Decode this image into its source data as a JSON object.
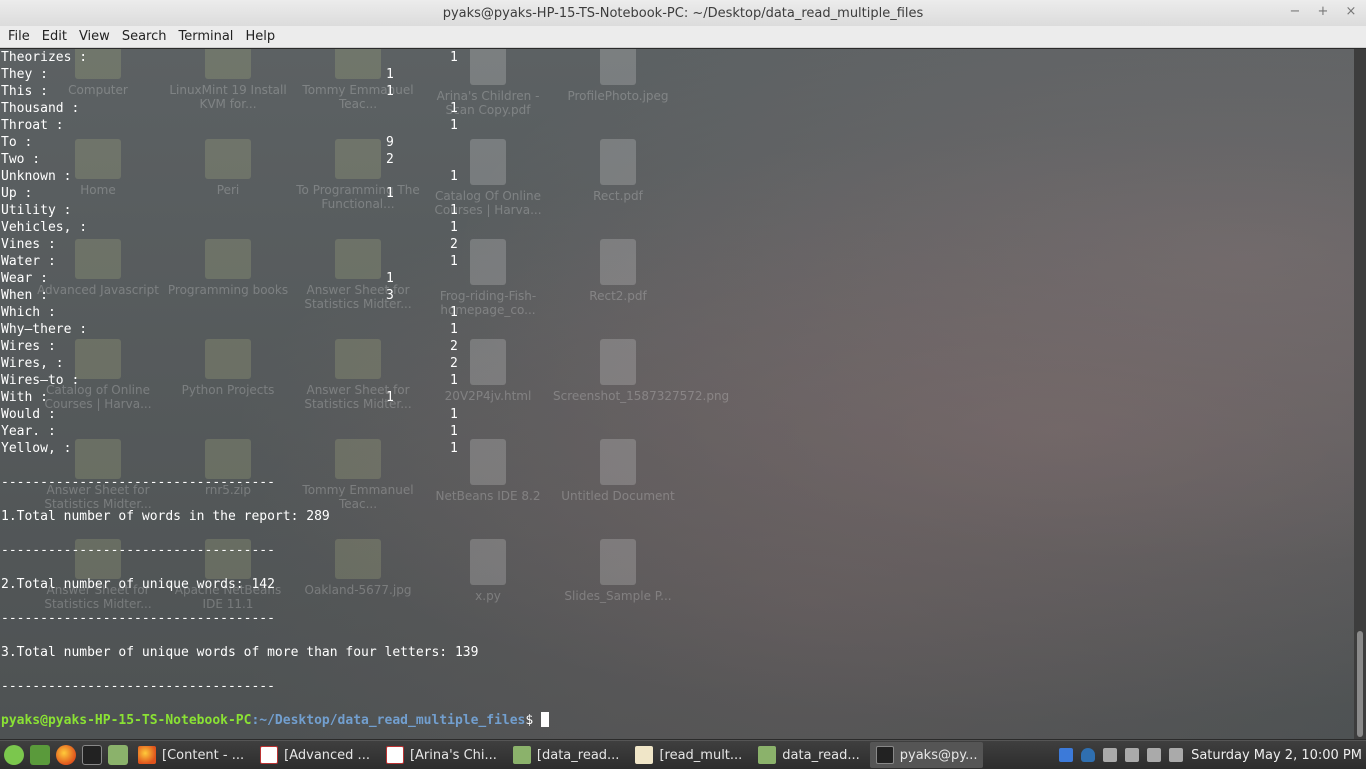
{
  "window": {
    "title": "pyaks@pyaks-HP-15-TS-Notebook-PC: ~/Desktop/data_read_multiple_files",
    "controls": [
      "−",
      "+",
      "×"
    ]
  },
  "menu": [
    "File",
    "Edit",
    "View",
    "Search",
    "Terminal",
    "Help"
  ],
  "terminal": {
    "word_counts": [
      {
        "word": "Theorizes :",
        "count": "1",
        "col": "wide"
      },
      {
        "word": "They :",
        "count": "1",
        "col": "tight"
      },
      {
        "word": "This :",
        "count": "1",
        "col": "tight"
      },
      {
        "word": "Thousand :",
        "count": "1",
        "col": "wide"
      },
      {
        "word": "Throat :",
        "count": "1",
        "col": "wide"
      },
      {
        "word": "To :",
        "count": "9",
        "col": "tight"
      },
      {
        "word": "Two :",
        "count": "2",
        "col": "tight"
      },
      {
        "word": "Unknown :",
        "count": "1",
        "col": "wide"
      },
      {
        "word": "Up :",
        "count": "1",
        "col": "tight"
      },
      {
        "word": "Utility :",
        "count": "1",
        "col": "wide"
      },
      {
        "word": "Vehicles, :",
        "count": "1",
        "col": "wide"
      },
      {
        "word": "Vines :",
        "count": "2",
        "col": "wide"
      },
      {
        "word": "Water :",
        "count": "1",
        "col": "wide"
      },
      {
        "word": "Wear :",
        "count": "1",
        "col": "tight"
      },
      {
        "word": "When :",
        "count": "3",
        "col": "tight"
      },
      {
        "word": "Which :",
        "count": "1",
        "col": "wide"
      },
      {
        "word": "Why—there :",
        "count": "1",
        "col": "wide"
      },
      {
        "word": "Wires :",
        "count": "2",
        "col": "wide"
      },
      {
        "word": "Wires, :",
        "count": "2",
        "col": "wide"
      },
      {
        "word": "Wires—to :",
        "count": "1",
        "col": "wide"
      },
      {
        "word": "With :",
        "count": "1",
        "col": "tight"
      },
      {
        "word": "Would :",
        "count": "1",
        "col": "wide"
      },
      {
        "word": "Year. :",
        "count": "1",
        "col": "wide"
      },
      {
        "word": "Yellow, :",
        "count": "1",
        "col": "wide"
      }
    ],
    "separator": "-----------------------------------",
    "total_words": "1.Total number of words in the report: 289",
    "unique_words": "2.Total number of unique words: 142",
    "unique_long_words": "3.Total number of unique words of more than four letters: 139",
    "prompt_user": "pyaks@pyaks-HP-15-TS-Notebook-PC",
    "prompt_path": ":~/Desktop/data_read_multiple_files",
    "prompt_symbol": "$ "
  },
  "desktop_icons": [
    {
      "label": "Computer"
    },
    {
      "label": "LinuxMint 19 Install KVM for..."
    },
    {
      "label": "Tommy Emmanuel Teac..."
    },
    {
      "label": "Arina's Children - Scan Copy.pdf"
    },
    {
      "label": "ProfilePhoto.jpeg"
    },
    {
      "label": "Home"
    },
    {
      "label": "Peri"
    },
    {
      "label": "To Programming The Functional..."
    },
    {
      "label": "Catalog Of Online Courses | Harva..."
    },
    {
      "label": "Rect.pdf"
    },
    {
      "label": "Advanced Javascript"
    },
    {
      "label": "Programming books"
    },
    {
      "label": "Answer Sheet for Statistics Midter..."
    },
    {
      "label": "Frog-riding-Fish-homepage_co..."
    },
    {
      "label": "Rect2.pdf"
    },
    {
      "label": "Catalog of Online Courses | Harva..."
    },
    {
      "label": "Python Projects"
    },
    {
      "label": "Answer Sheet for Statistics Midter..."
    },
    {
      "label": "20V2P4jv.html"
    },
    {
      "label": "Screenshot_1587327572.png"
    },
    {
      "label": "Answer Sheet for Statistics Midter..."
    },
    {
      "label": "rnr5.zip"
    },
    {
      "label": "Tommy Emmanuel Teac..."
    },
    {
      "label": "NetBeans IDE 8.2"
    },
    {
      "label": "Untitled Document"
    },
    {
      "label": "Answer Sheet for Statistics Midter..."
    },
    {
      "label": "Apache NetBeans IDE 11.1"
    },
    {
      "label": "Oakland-5677.jpg"
    },
    {
      "label": "x.py"
    },
    {
      "label": "Slides_Sample P..."
    }
  ],
  "taskbar": {
    "tasks": [
      {
        "label": "[Content - ...",
        "icon": "firefox-icon"
      },
      {
        "label": "[Advanced ...",
        "icon": "pdf-icon"
      },
      {
        "label": "[Arina's Chi...",
        "icon": "pdf-icon"
      },
      {
        "label": "[data_read...",
        "icon": "folder-icon"
      },
      {
        "label": "[read_mult...",
        "icon": "text-editor-icon"
      },
      {
        "label": "data_read...",
        "icon": "folder-icon"
      },
      {
        "label": "pyaks@py...",
        "icon": "terminal-icon",
        "active": true
      }
    ],
    "clock": "Saturday May  2, 10:00 PM"
  }
}
